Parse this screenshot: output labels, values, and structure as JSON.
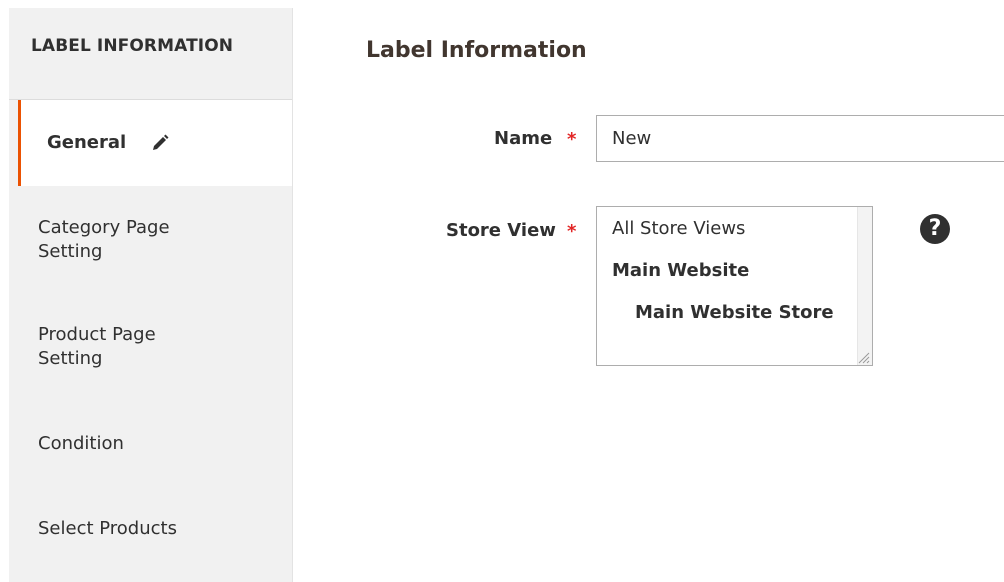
{
  "sidebar": {
    "title": "LABEL INFORMATION",
    "items": [
      {
        "label": "General",
        "active": true,
        "icon": "pencil-icon"
      },
      {
        "label": "Category Page Setting"
      },
      {
        "label": "Product Page Setting"
      },
      {
        "label": "Condition"
      },
      {
        "label": "Select Products"
      }
    ]
  },
  "main": {
    "title": "Label Information",
    "fields": {
      "name": {
        "label": "Name",
        "required_mark": "*",
        "value": "New"
      },
      "store_view": {
        "label": "Store View",
        "required_mark": "*",
        "options": [
          "All Store Views",
          "Main Website",
          "Main Website Store"
        ],
        "help_icon": "question-icon",
        "help_glyph": "?"
      }
    }
  },
  "colors": {
    "accent": "#eb5202",
    "required": "#e22626",
    "sidebar_bg": "#f1f1f1"
  }
}
